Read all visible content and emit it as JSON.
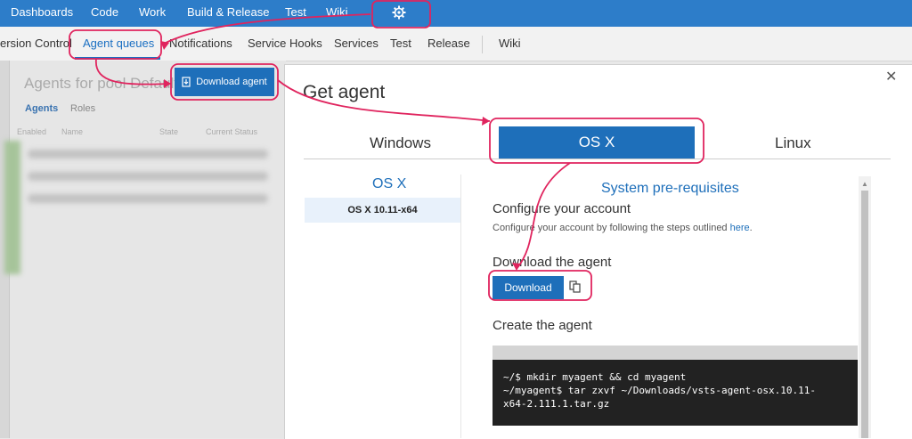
{
  "topnav": {
    "items": [
      "Dashboards",
      "Code",
      "Work",
      "Build & Release",
      "Test",
      "Wiki"
    ],
    "gear_icon": "gear-icon"
  },
  "subnav": {
    "items": [
      "ersion Control",
      "Agent queues",
      "Notifications",
      "Service Hooks",
      "Services",
      "Test",
      "Release",
      "Wiki"
    ]
  },
  "background_page": {
    "title": "Agents for pool Default",
    "tabs": [
      "Agents",
      "Roles"
    ],
    "headers": [
      "Enabled",
      "Name",
      "State",
      "Current Status"
    ]
  },
  "download_agent_button": "Download agent",
  "modal": {
    "title": "Get agent",
    "tabs": [
      "Windows",
      "OS X",
      "Linux"
    ],
    "side": {
      "heading": "OS X",
      "item": "OS X 10.11-x64"
    },
    "section_title": "System pre-requisites",
    "configure_heading": "Configure your account",
    "configure_text": "Configure your account by following the steps outlined",
    "configure_link": "here",
    "download_heading": "Download the agent",
    "download_button": "Download",
    "create_heading": "Create the agent",
    "code_lines": [
      "~/$ mkdir myagent && cd myagent",
      "~/myagent$ tar zxvf ~/Downloads/vsts-agent-osx.10.11-",
      "x64-2.111.1.tar.gz"
    ]
  },
  "colors": {
    "accent": "#1e6fba",
    "topnav": "#2d7dc9",
    "annotation": "#e0245e"
  }
}
